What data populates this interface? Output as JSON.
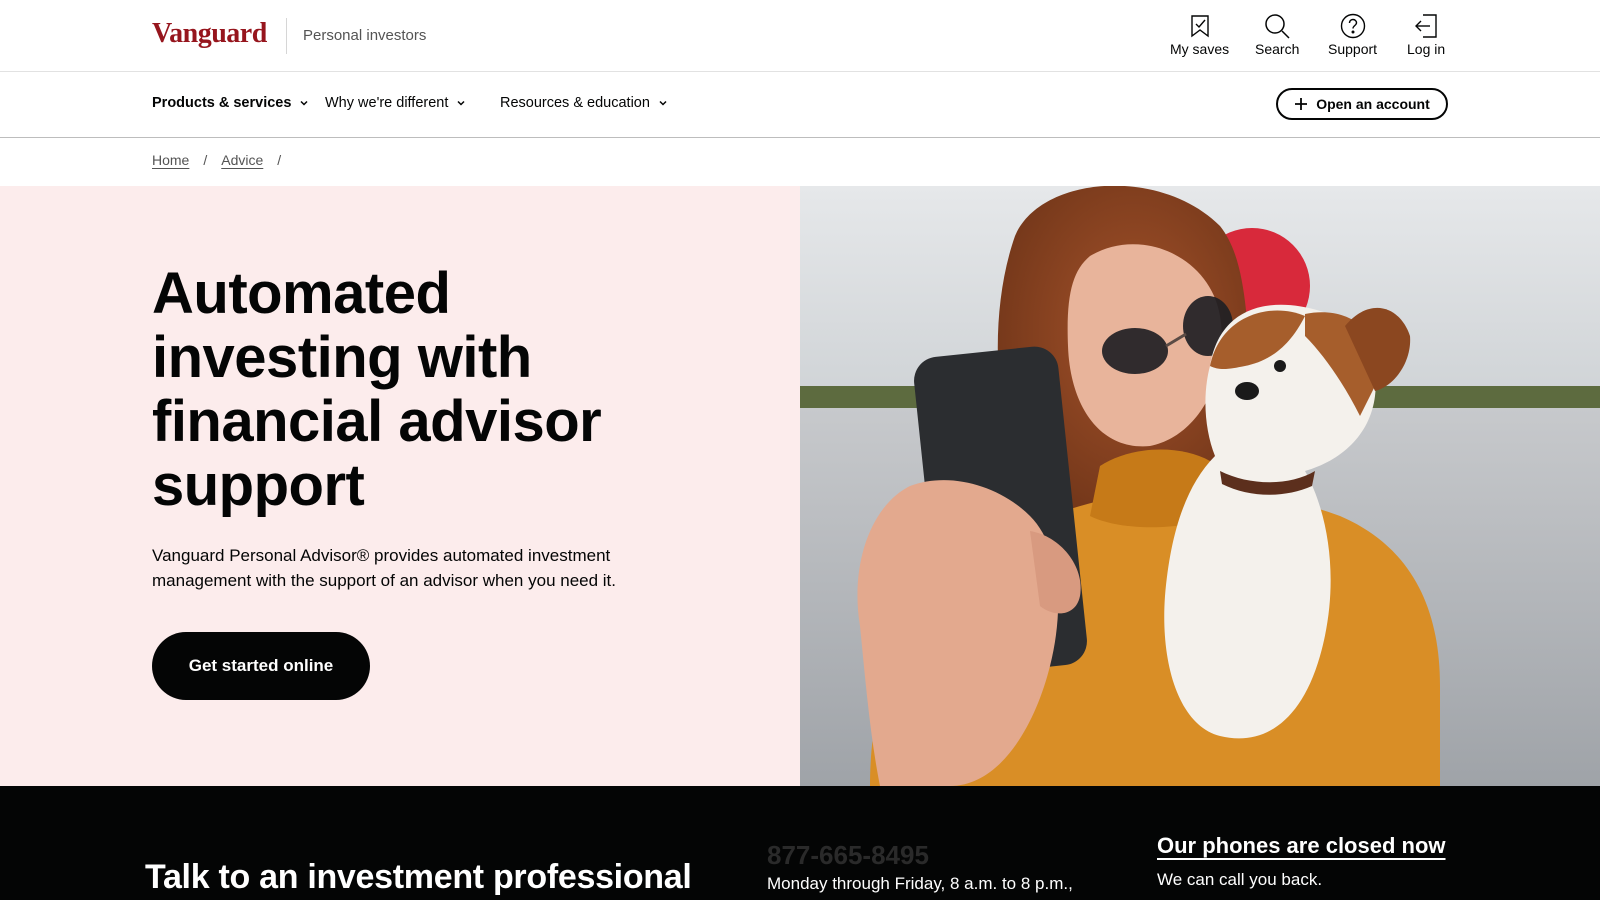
{
  "header": {
    "brand": "Vanguard",
    "segment": "Personal investors",
    "utilities": [
      {
        "label": "My saves",
        "icon": "bookmark-icon"
      },
      {
        "label": "Search",
        "icon": "search-icon"
      },
      {
        "label": "Support",
        "icon": "question-circle-icon"
      },
      {
        "label": "Log in",
        "icon": "login-icon"
      }
    ]
  },
  "nav": {
    "items": [
      {
        "label": "Products & services",
        "active": true
      },
      {
        "label": "Why we're different"
      },
      {
        "label": "Resources & education"
      }
    ],
    "open_account_label": "Open an account"
  },
  "breadcrumb": {
    "items": [
      "Home",
      "Advice"
    ],
    "separator": "/"
  },
  "hero": {
    "title": "Automated investing with financial advisor support",
    "description": "Vanguard Personal Advisor® provides automated investment management with the support of an advisor when you need it.",
    "cta_label": "Get started online",
    "image_alt": "Woman with sunglasses taking a selfie while kissing a small dog"
  },
  "contact_band": {
    "title": "Talk to an investment professional",
    "phone": "877-665-8495",
    "hours": "Monday through Friday, 8 a.m. to 8 p.m.,",
    "status_heading": "Our phones are closed now",
    "callback_text": "We can call you back."
  },
  "colors": {
    "brand_red": "#96151d",
    "hero_bg": "#fcecec",
    "text_dark": "#040505",
    "band_bg": "#040505"
  }
}
